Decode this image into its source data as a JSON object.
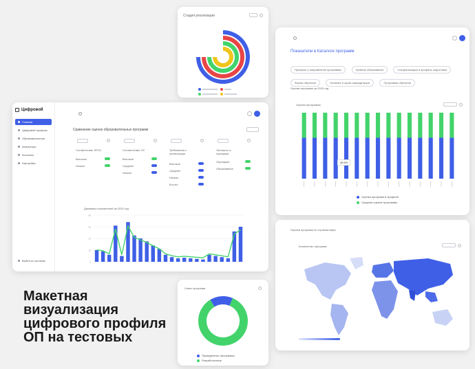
{
  "hero_text": "Макетная визуализация цифрового профиля ОП на тестовых",
  "colors": {
    "accent_blue": "#3f5fe6",
    "accent_green": "#43d36b",
    "accent_red": "#e84545",
    "accent_yellow": "#f0c419"
  },
  "radial_card": {
    "title": "Стадия реализации"
  },
  "main_panel": {
    "logo": "Цифровой",
    "sidebar_items": [
      "Главная",
      "Цифровой профиль",
      "Образовательная",
      "Аналитика",
      "Контакты",
      "Настройки"
    ],
    "bottom_link": "Выйти из системы",
    "section_title": "Сравнение оценок образовательных программ",
    "cards": [
      {
        "title": "Соответствие ФГОС",
        "rows": [
          "Высокое",
          "Низкое"
        ]
      },
      {
        "title": "Соответствие ПС",
        "rows": [
          "Высокое",
          "Среднее",
          "Низкое"
        ]
      },
      {
        "title": "Требования к организации",
        "rows": [
          "Высокое",
          "Среднее",
          "Низкое",
          "Кол-во"
        ]
      },
      {
        "title": "Эксперты и оценщики",
        "rows": [
          "Оценщики",
          "Образование"
        ]
      }
    ],
    "chart_title": "Динамика показателей за 2020 год"
  },
  "right_top": {
    "heading": "Показатели в Каталоге программ",
    "filters": [
      "Профиль и направление программы",
      "Уровень образования",
      "Специализация и профиль подготовки",
      "Форма обучения",
      "Наличие и сроки аккредитации",
      "Программа обучения"
    ],
    "subtitle": "Оценки программ за 2020 год",
    "chart_label": "Оценка программы",
    "tooltip": "45.6%",
    "legend": [
      "Оценка программ в профиле",
      "Средняя оценка программы"
    ]
  },
  "right_bottom": {
    "heading": "Оценка программ по странам мира",
    "map_label": "Количество программ"
  },
  "donut_card": {
    "title": "Охват программ",
    "legend": [
      "Проведенные программы",
      "Разработанные"
    ]
  },
  "chart_data": [
    {
      "type": "bar",
      "title": "",
      "categories": [
        "1",
        "2",
        "3",
        "4",
        "5",
        "6",
        "7",
        "8",
        "9",
        "10",
        "11",
        "12",
        "13",
        "14",
        "15",
        "16",
        "17",
        "18",
        "19",
        "20",
        "21",
        "22",
        "23",
        "24"
      ],
      "series": [
        {
          "values": [
            20,
            18,
            12,
            62,
            10,
            68,
            45,
            40,
            35,
            28,
            22,
            12,
            8,
            6,
            7,
            6,
            5,
            4,
            12,
            10,
            8,
            6,
            52,
            60
          ]
        }
      ],
      "ylim": [
        0,
        80
      ]
    },
    {
      "type": "bar",
      "title": "",
      "categories": [
        "1",
        "2",
        "3",
        "4",
        "5",
        "6",
        "7",
        "8",
        "9",
        "10",
        "11",
        "12",
        "13",
        "14",
        "15"
      ],
      "series": [
        {
          "values": [
            62,
            62,
            62,
            62,
            62,
            62,
            62,
            62,
            62,
            62,
            62,
            62,
            62,
            62,
            62
          ]
        },
        {
          "values": [
            38,
            38,
            38,
            38,
            38,
            38,
            38,
            38,
            38,
            38,
            38,
            38,
            38,
            38,
            38
          ]
        }
      ],
      "ylim": [
        0,
        100
      ]
    },
    {
      "type": "pie",
      "title": "",
      "categories": [
        "Проведенные программы",
        "Разработанные"
      ],
      "values": [
        85,
        15
      ]
    }
  ]
}
